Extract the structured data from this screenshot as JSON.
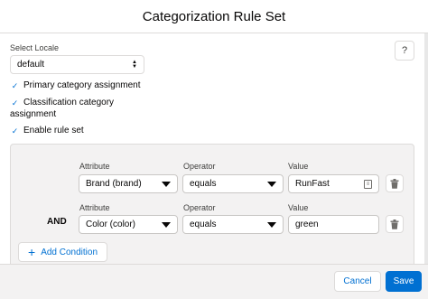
{
  "dialog": {
    "title": "Categorization Rule Set"
  },
  "help": {
    "label": "?"
  },
  "locale": {
    "label": "Select Locale",
    "value": "default"
  },
  "checkboxes": {
    "primary": {
      "label": "Primary category assignment",
      "checked": true
    },
    "classification": {
      "label": "Classification category assignment",
      "checked": true
    },
    "enable": {
      "label": "Enable rule set",
      "checked": true
    }
  },
  "conditions": [
    {
      "connector": "",
      "attribute_label": "Attribute",
      "attribute": "Brand (brand)",
      "operator_label": "Operator",
      "operator": "equals",
      "value_label": "Value",
      "value": "RunFast"
    },
    {
      "connector": "AND",
      "attribute_label": "Attribute",
      "attribute": "Color (color)",
      "operator_label": "Operator",
      "operator": "equals",
      "value_label": "Value",
      "value": "green"
    }
  ],
  "add_condition": {
    "label": "Add Condition"
  },
  "footer": {
    "cancel_label": "Cancel",
    "save_label": "Save"
  },
  "colors": {
    "accent": "#0070d2",
    "panel_bg": "#f3f2f2",
    "border": "#dddbda"
  },
  "icons": {
    "help": "question-icon",
    "stepper": "up-down-icon",
    "check": "check-icon",
    "caret": "chevron-down-icon",
    "lookup": "lookup-icon",
    "delete": "trash-icon",
    "add": "plus-icon"
  }
}
